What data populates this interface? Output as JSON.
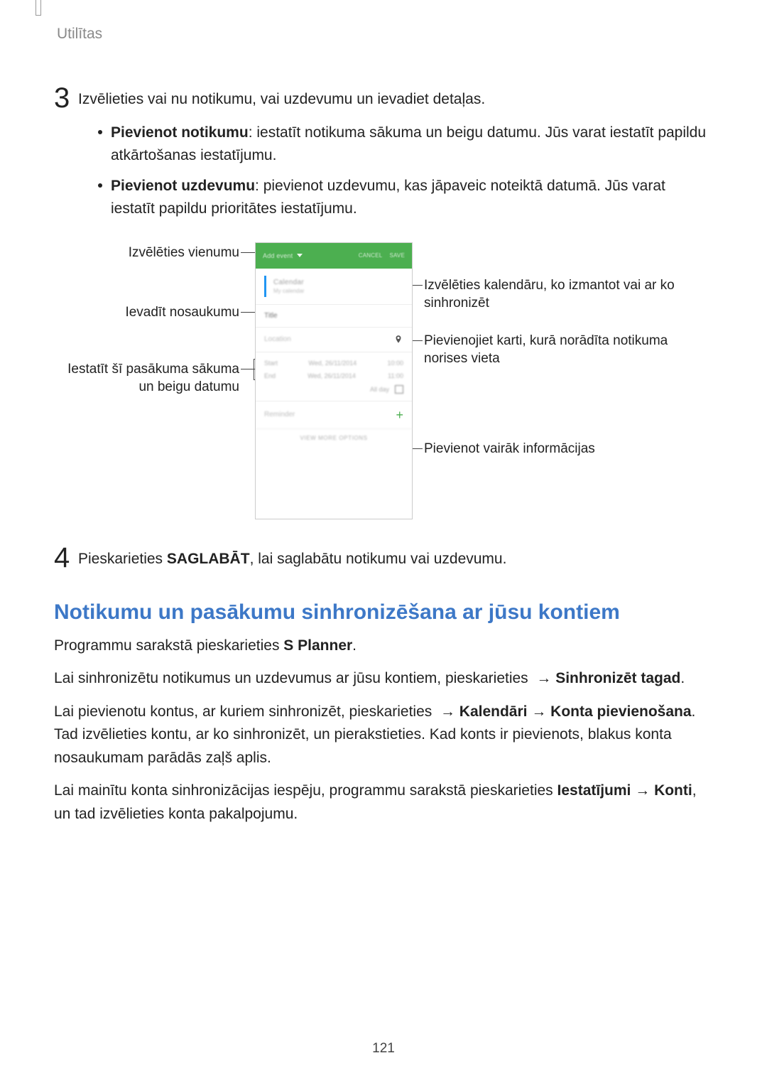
{
  "header": {
    "section_label": "Utilītas"
  },
  "step3": {
    "number": "3",
    "intro": "Izvēlieties vai nu notikumu, vai uzdevumu un ievadiet detaļas.",
    "bullets": [
      {
        "strong": "Pievienot notikumu",
        "rest": ": iestatīt notikuma sākuma un beigu datumu. Jūs varat iestatīt papildu atkārtošanas iestatījumu."
      },
      {
        "strong": "Pievienot uzdevumu",
        "rest": ": pievienot uzdevumu, kas jāpaveic noteiktā datumā. Jūs varat iestatīt papildu prioritātes iestatījumu."
      }
    ]
  },
  "figure": {
    "left": {
      "c1": "Izvēlēties vienumu",
      "c2": "Ievadīt nosaukumu",
      "c3": "Iestatīt šī pasākuma sākuma un beigu datumu"
    },
    "right": {
      "c1": "Izvēlēties kalendāru, ko izmantot vai ar ko sinhronizēt",
      "c2": "Pievienojiet karti, kurā norādīta notikuma norises vieta",
      "c3": "Pievienot vairāk informācijas"
    },
    "phone": {
      "add_event": "Add event",
      "cancel": "CANCEL",
      "save": "SAVE",
      "calendar": "Calendar",
      "sub": "My calendar",
      "title": "Title",
      "location": "Location",
      "start": "Start",
      "end": "End",
      "date1": "Wed, 26/11/2014",
      "time1": "10:00",
      "date2": "Wed, 26/11/2014",
      "time2": "11:00",
      "allday": "All day",
      "reminder": "Reminder",
      "more": "VIEW MORE OPTIONS"
    }
  },
  "step4": {
    "number": "4",
    "before": "Pieskarieties ",
    "strong": "SAGLABĀT",
    "after": ", lai saglabātu notikumu vai uzdevumu."
  },
  "section2": {
    "heading": "Notikumu un pasākumu sinhronizēšana ar jūsu kontiem",
    "p1_before": "Programmu sarakstā pieskarieties ",
    "p1_strong": "S Planner",
    "p1_after": ".",
    "p2_before": "Lai sinhronizētu notikumus un uzdevumus ar jūsu kontiem, pieskarieties ",
    "p2_arrow": " → ",
    "p2_strong": "Sinhronizēt tagad",
    "p2_after": ".",
    "p3_before": "Lai pievienotu kontus, ar kuriem sinhronizēt, pieskarieties ",
    "p3_arrow1": " → ",
    "p3_strong1": "Kalendāri",
    "p3_arrow2": " → ",
    "p3_strong2": "Konta pievienošana",
    "p3_after": ". Tad izvēlieties kontu, ar ko sinhronizēt, un pierakstieties. Kad konts ir pievienots, blakus konta nosaukumam parādās zaļš aplis.",
    "p4_before": "Lai mainītu konta sinhronizācijas iespēju, programmu sarakstā pieskarieties ",
    "p4_strong1": "Iestatījumi",
    "p4_arrow": " → ",
    "p4_strong2": "Konti",
    "p4_after": ", un tad izvēlieties konta pakalpojumu."
  },
  "footer": {
    "page_number": "121"
  }
}
